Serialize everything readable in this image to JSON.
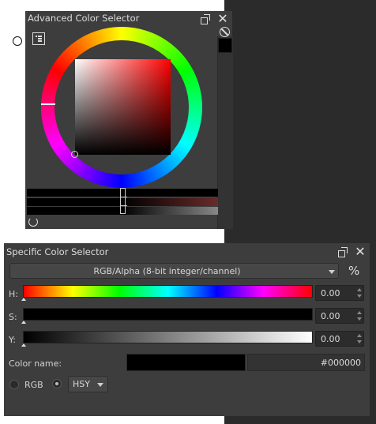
{
  "advanced": {
    "title": "Advanced Color Selector",
    "current_color": "#000000"
  },
  "specific": {
    "title": "Specific Color Selector",
    "color_model": "RGB/Alpha (8-bit integer/channel)",
    "percent_toggle": "%",
    "sliders": [
      {
        "label": "H:",
        "value": "0.00"
      },
      {
        "label": "S:",
        "value": "0.00"
      },
      {
        "label": "Y:",
        "value": "0.00"
      }
    ],
    "color_name_label": "Color name:",
    "hex_value": "#000000",
    "mode_rgb_label": "RGB",
    "mode_hsy_option": "HSY",
    "mode_selected": "HSY"
  }
}
